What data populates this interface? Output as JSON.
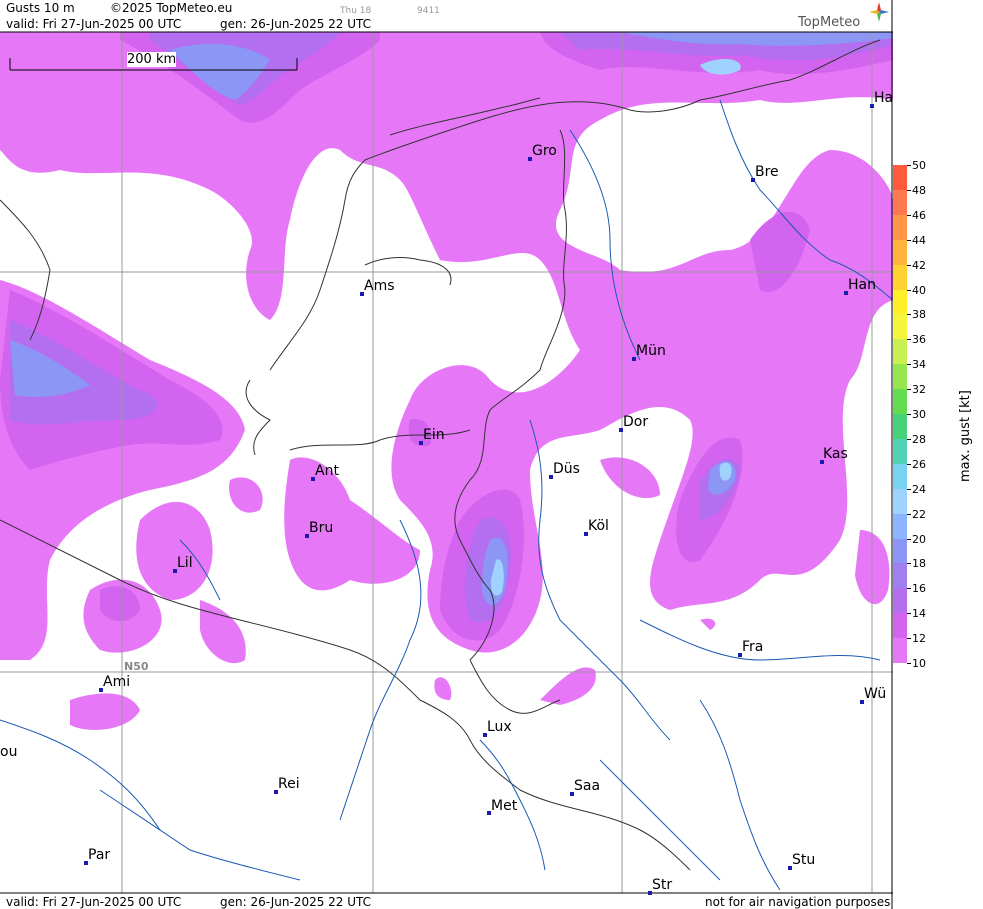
{
  "header": {
    "product": "Gusts 10 m",
    "copyright": "©2025 TopMeteo.eu",
    "step_code": "Thu 18",
    "run_code": "9411",
    "valid": "valid:  Fri  27-Jun-2025  00 UTC",
    "gen": "gen: 26-Jun-2025 22 UTC",
    "logo": "TopMeteo"
  },
  "footer": {
    "valid": "valid:  Fri  27-Jun-2025  00 UTC",
    "gen": "gen: 26-Jun-2025 22 UTC",
    "disclaimer": "not for air navigation purposes"
  },
  "scale_bar": {
    "label": "200 km"
  },
  "latitude_label": "N50",
  "cities": [
    {
      "name": "Gro"
    },
    {
      "name": "Bre"
    },
    {
      "name": "Ha"
    },
    {
      "name": "Ams"
    },
    {
      "name": "Han"
    },
    {
      "name": "Mün"
    },
    {
      "name": "Ein"
    },
    {
      "name": "Dor"
    },
    {
      "name": "Kas"
    },
    {
      "name": "Ant"
    },
    {
      "name": "Düs"
    },
    {
      "name": "Köl"
    },
    {
      "name": "Bru"
    },
    {
      "name": "Lil"
    },
    {
      "name": "Fra"
    },
    {
      "name": "Ami"
    },
    {
      "name": "Wü"
    },
    {
      "name": "Lux"
    },
    {
      "name": "ou"
    },
    {
      "name": "Rei"
    },
    {
      "name": "Saa"
    },
    {
      "name": "Met"
    },
    {
      "name": "Stu"
    },
    {
      "name": "Par"
    },
    {
      "name": "Str"
    }
  ],
  "legend": {
    "title": "max. gust [kt]",
    "ticks": [
      "50",
      "48",
      "46",
      "44",
      "42",
      "40",
      "38",
      "36",
      "34",
      "32",
      "30",
      "28",
      "26",
      "24",
      "22",
      "20",
      "18",
      "16",
      "14",
      "12",
      "10"
    ],
    "colors": [
      "#ff5a3c",
      "#ff7850",
      "#ff9646",
      "#ffb43c",
      "#ffd232",
      "#ffef28",
      "#f5f53c",
      "#c8f050",
      "#96e650",
      "#64dc50",
      "#46d278",
      "#50d2b4",
      "#78d2f0",
      "#a0d2ff",
      "#8cb4ff",
      "#8c96f5",
      "#a07ff0",
      "#b46ef0",
      "#d264f0",
      "#e678f8"
    ]
  },
  "colors": {
    "gust_12_14": "#e678f8",
    "gust_14_16": "#d264f0",
    "gust_16_18": "#b46ef0",
    "gust_18_20": "#a07ff0",
    "gust_20_22": "#8c96f5",
    "gust_22_24": "#8cb4ff",
    "gust_24_26": "#a0d2ff"
  }
}
